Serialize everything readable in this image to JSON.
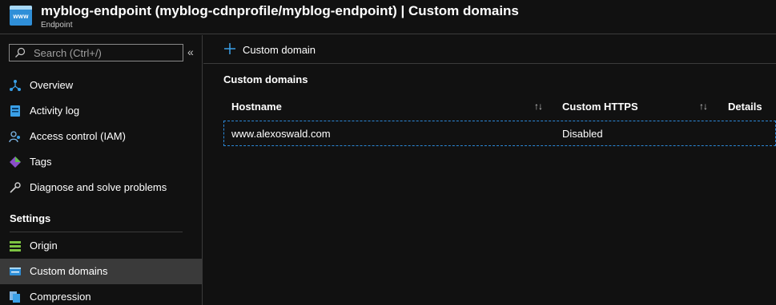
{
  "header": {
    "title": "myblog-endpoint (myblog-cdnprofile/myblog-endpoint) | Custom domains",
    "subtitle": "Endpoint",
    "icon_text": "www"
  },
  "sidebar": {
    "search_placeholder": "Search (Ctrl+/)",
    "collapse_glyph": "«",
    "items": [
      {
        "label": "Overview",
        "icon": "overview-icon"
      },
      {
        "label": "Activity log",
        "icon": "activity-log-icon"
      },
      {
        "label": "Access control (IAM)",
        "icon": "iam-icon"
      },
      {
        "label": "Tags",
        "icon": "tag-icon"
      },
      {
        "label": "Diagnose and solve problems",
        "icon": "wrench-icon"
      }
    ],
    "section_title": "Settings",
    "settings_items": [
      {
        "label": "Origin",
        "icon": "origin-icon"
      },
      {
        "label": "Custom domains",
        "icon": "custom-domains-icon",
        "active": true
      },
      {
        "label": "Compression",
        "icon": "compression-icon"
      }
    ]
  },
  "main": {
    "add_button_label": "Custom domain",
    "grid_title": "Custom domains",
    "columns": [
      "Hostname",
      "Custom HTTPS",
      "Details"
    ],
    "sort_glyph": "↑↓",
    "rows": [
      {
        "hostname": "www.alexoswald.com",
        "https": "Disabled",
        "details": ""
      }
    ]
  },
  "colors": {
    "background": "#111111",
    "accent": "#2b88d8",
    "active_item": "#3a3a3a"
  }
}
